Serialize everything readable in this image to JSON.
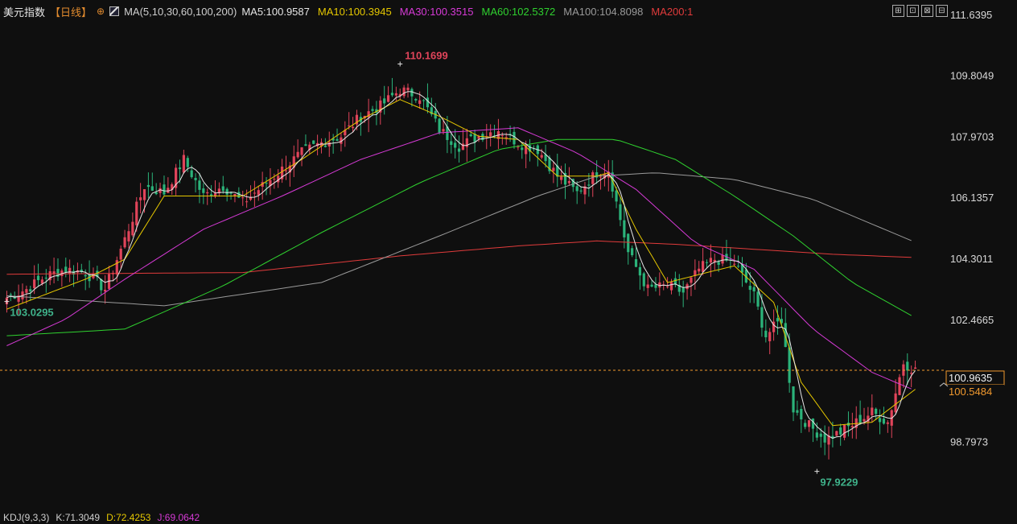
{
  "header": {
    "symbol": "美元指数",
    "period": "【日线】",
    "circle": "⊕",
    "ma_params": "MA(5,10,30,60,100,200)",
    "ma_values": [
      {
        "text": "MA5:100.9587",
        "color": "#e6e6e6"
      },
      {
        "text": "MA10:100.3945",
        "color": "#e5c700"
      },
      {
        "text": "MA30:100.3515",
        "color": "#d63ad6"
      },
      {
        "text": "MA60:102.5372",
        "color": "#2fd12f"
      },
      {
        "text": "MA100:104.8098",
        "color": "#9a9a9a"
      },
      {
        "text": "MA200:1",
        "color": "#e03b3b"
      }
    ]
  },
  "toolbar": {
    "icons": [
      "crosshair-icon",
      "bar-style-icon",
      "candle-style-icon",
      "line-style-icon"
    ],
    "glyphs": [
      "⊞",
      "⊡",
      "⊠",
      "⊟"
    ]
  },
  "kdj": {
    "label": "KDJ(9,3,3)",
    "k": "K:71.3049",
    "d": "D:72.4253",
    "j": "J:69.0642",
    "colors": {
      "k": "#cfcfcf",
      "d": "#e5c700",
      "j": "#d63ad6"
    }
  },
  "colors": {
    "up": "#e0445a",
    "down": "#2bb37a",
    "bg": "#0f0f0f",
    "axis_text": "#d8d8d8",
    "last_price": "#f29a2e",
    "ma5": "#e6e6e6",
    "ma10": "#e5c700",
    "ma30": "#d63ad6",
    "ma60": "#2fd12f",
    "ma100": "#9a9a9a",
    "ma200": "#e03b3b"
  },
  "chart_data": {
    "type": "candlestick",
    "y_ticks": [
      "111.6395",
      "109.8049",
      "107.9703",
      "106.1357",
      "104.3011",
      "102.4665",
      "98.7973"
    ],
    "y_range": [
      96.8,
      111.9
    ],
    "last_price": {
      "label": "100.9635",
      "value": 100.9635
    },
    "secondary_label": {
      "label": "100.5484",
      "value": 100.5484
    },
    "annotations": [
      {
        "text": "110.1699",
        "value": 110.1699,
        "bar": 100,
        "kind": "high"
      },
      {
        "text": "103.0295",
        "value": 103.0295,
        "bar": 0,
        "kind": "low"
      },
      {
        "text": "97.9229",
        "value": 97.9229,
        "bar": 206,
        "kind": "low"
      }
    ],
    "close_anchors": [
      [
        0,
        103.15
      ],
      [
        5,
        103.4
      ],
      [
        10,
        103.8
      ],
      [
        15,
        104.0
      ],
      [
        20,
        103.9
      ],
      [
        25,
        103.4
      ],
      [
        30,
        104.9
      ],
      [
        35,
        106.5
      ],
      [
        40,
        106.3
      ],
      [
        45,
        107.3
      ],
      [
        50,
        106.2
      ],
      [
        55,
        106.5
      ],
      [
        60,
        106.0
      ],
      [
        65,
        106.5
      ],
      [
        70,
        107.0
      ],
      [
        75,
        107.5
      ],
      [
        80,
        107.8
      ],
      [
        85,
        108.0
      ],
      [
        90,
        108.6
      ],
      [
        95,
        108.9
      ],
      [
        100,
        109.4
      ],
      [
        105,
        109.2
      ],
      [
        110,
        108.2
      ],
      [
        115,
        107.7
      ],
      [
        120,
        108.0
      ],
      [
        125,
        108.2
      ],
      [
        130,
        107.8
      ],
      [
        135,
        107.6
      ],
      [
        140,
        106.8
      ],
      [
        145,
        106.3
      ],
      [
        150,
        106.9
      ],
      [
        153,
        107.0
      ],
      [
        158,
        104.5
      ],
      [
        163,
        103.4
      ],
      [
        168,
        103.5
      ],
      [
        172,
        103.3
      ],
      [
        176,
        104.0
      ],
      [
        180,
        104.3
      ],
      [
        185,
        104.2
      ],
      [
        190,
        103.2
      ],
      [
        193,
        102.0
      ],
      [
        197,
        102.5
      ],
      [
        200,
        99.8
      ],
      [
        204,
        99.3
      ],
      [
        208,
        98.9
      ],
      [
        212,
        99.1
      ],
      [
        216,
        99.4
      ],
      [
        220,
        99.7
      ],
      [
        224,
        99.4
      ],
      [
        228,
        101.2
      ],
      [
        231,
        100.96
      ]
    ],
    "ma_series_anchors": {
      "ma10": [
        [
          0,
          102.8
        ],
        [
          20,
          103.7
        ],
        [
          30,
          104.3
        ],
        [
          40,
          106.2
        ],
        [
          60,
          106.2
        ],
        [
          75,
          107.3
        ],
        [
          90,
          108.5
        ],
        [
          100,
          109.1
        ],
        [
          110,
          108.6
        ],
        [
          120,
          108.0
        ],
        [
          130,
          107.9
        ],
        [
          140,
          106.8
        ],
        [
          150,
          106.8
        ],
        [
          153,
          106.9
        ],
        [
          160,
          105.2
        ],
        [
          168,
          103.6
        ],
        [
          178,
          103.9
        ],
        [
          185,
          104.1
        ],
        [
          195,
          103.0
        ],
        [
          202,
          100.6
        ],
        [
          210,
          99.3
        ],
        [
          220,
          99.4
        ],
        [
          231,
          100.39
        ]
      ],
      "ma30": [
        [
          0,
          101.7
        ],
        [
          15,
          102.5
        ],
        [
          30,
          103.7
        ],
        [
          50,
          105.2
        ],
        [
          70,
          106.2
        ],
        [
          90,
          107.3
        ],
        [
          110,
          108.1
        ],
        [
          130,
          108.25
        ],
        [
          145,
          107.5
        ],
        [
          160,
          106.4
        ],
        [
          175,
          104.8
        ],
        [
          190,
          104.0
        ],
        [
          205,
          102.2
        ],
        [
          220,
          100.9
        ],
        [
          231,
          100.35
        ]
      ],
      "ma60": [
        [
          0,
          102.0
        ],
        [
          30,
          102.2
        ],
        [
          55,
          103.5
        ],
        [
          80,
          105.1
        ],
        [
          105,
          106.6
        ],
        [
          125,
          107.6
        ],
        [
          140,
          107.9
        ],
        [
          155,
          107.9
        ],
        [
          170,
          107.3
        ],
        [
          185,
          106.2
        ],
        [
          200,
          105.0
        ],
        [
          215,
          103.6
        ],
        [
          231,
          102.54
        ]
      ],
      "ma100": [
        [
          0,
          103.2
        ],
        [
          40,
          102.9
        ],
        [
          80,
          103.6
        ],
        [
          110,
          105.0
        ],
        [
          135,
          106.2
        ],
        [
          150,
          106.8
        ],
        [
          165,
          106.9
        ],
        [
          185,
          106.7
        ],
        [
          205,
          106.1
        ],
        [
          231,
          104.81
        ]
      ],
      "ma200": [
        [
          0,
          103.85
        ],
        [
          60,
          103.9
        ],
        [
          100,
          104.4
        ],
        [
          130,
          104.7
        ],
        [
          150,
          104.85
        ],
        [
          170,
          104.75
        ],
        [
          190,
          104.6
        ],
        [
          210,
          104.45
        ],
        [
          231,
          104.35
        ]
      ]
    },
    "bar_count": 232
  }
}
